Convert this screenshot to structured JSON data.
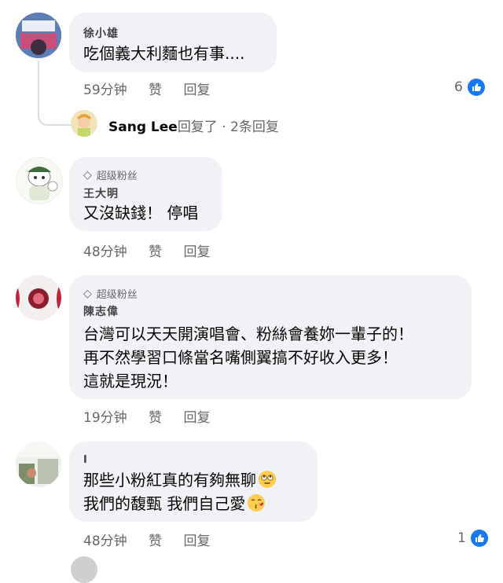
{
  "comments": [
    {
      "author": "徐小雄",
      "text": "吃個義大利麵也有事....",
      "time": "59分钟",
      "like": "赞",
      "reply": "回复",
      "reactions": "6"
    },
    {
      "badge": "超级粉丝",
      "author": "王大明",
      "text": "又沒缺錢！ 停唱",
      "time": "48分钟",
      "like": "赞",
      "reply": "回复"
    },
    {
      "badge": "超级粉丝",
      "author": "陳志偉",
      "lines": [
        "台灣可以天天開演唱會、粉絲會養妳一輩子的！",
        "再不然學習口條當名嘴側翼搞不好收入更多！",
        "這就是現況！"
      ],
      "time": "19分钟",
      "like": "赞",
      "reply": "回复"
    },
    {
      "author": "I",
      "lines": [
        "那些小粉紅真的有夠無聊",
        "我們的馥甄 我們自己愛"
      ],
      "emojis": [
        "face-with-rolling-eyes-emoji",
        "kissing-face-emoji"
      ],
      "time": "48分钟",
      "like": "赞",
      "reply": "回复",
      "reactions": "1"
    }
  ],
  "reply_thread": {
    "author": "Sang Lee",
    "text": "回复了 · 2条回复"
  },
  "colors": {
    "bubble": "#f0f2f5",
    "meta": "#65676b",
    "like_blue": "#1877f2"
  }
}
